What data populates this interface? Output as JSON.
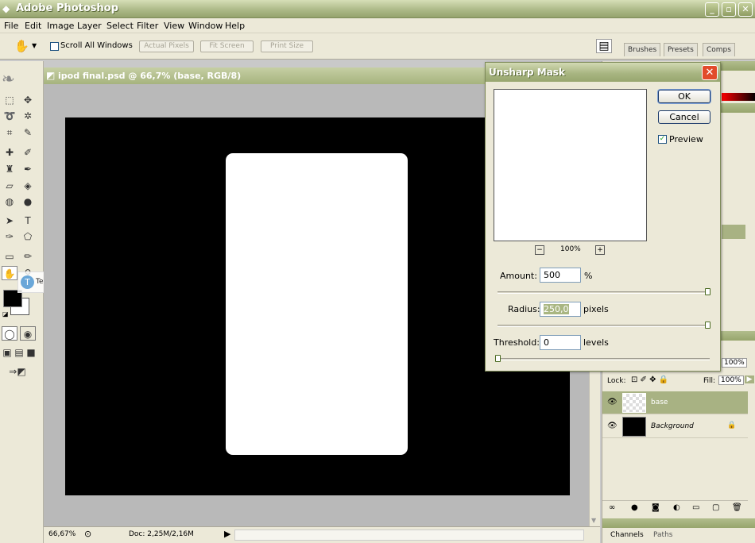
{
  "app": {
    "title": "Adobe Photoshop"
  },
  "window_controls": {
    "minimize": "_",
    "maximize": "▫",
    "close": "✕"
  },
  "menu": [
    "File",
    "Edit",
    "Image",
    "Layer",
    "Select",
    "Filter",
    "View",
    "Window",
    "Help"
  ],
  "options_bar": {
    "scroll_all_windows": "Scroll All Windows",
    "actual_pixels": "Actual Pixels",
    "fit_screen": "Fit Screen",
    "print_size": "Print Size",
    "palette_tabs": [
      "Brushes",
      "Presets",
      "Comps"
    ]
  },
  "document": {
    "title": "ipod final.psd @ 66,7% (base, RGB/8)",
    "zoom": "66,67%",
    "doc_info": "Doc: 2,25M/2,16M"
  },
  "watermark": {
    "text": "TechTut.com"
  },
  "dialog": {
    "title": "Unsharp Mask",
    "ok": "OK",
    "cancel": "Cancel",
    "preview_label": "Preview",
    "preview_checked": true,
    "zoom_out": "−",
    "zoom_value": "100%",
    "zoom_in": "+",
    "amount_label": "Amount:",
    "amount_value": "500",
    "amount_unit": "%",
    "radius_label": "Radius:",
    "radius_value": "250,0",
    "radius_unit": "pixels",
    "threshold_label": "Threshold:",
    "threshold_value": "0",
    "threshold_unit": "levels"
  },
  "layers_panel": {
    "opacity_value": "100%",
    "lock_label": "Lock:",
    "fill_label": "Fill:",
    "fill_value": "100%",
    "layers": [
      {
        "name": "base",
        "selected": true
      },
      {
        "name": "Background",
        "selected": false,
        "locked": true
      }
    ],
    "bottom_tabs": [
      "Channels",
      "Paths"
    ]
  },
  "colors": {
    "titlebar": "#a9b682",
    "selection": "#a8b283",
    "canvas": "#000000"
  }
}
